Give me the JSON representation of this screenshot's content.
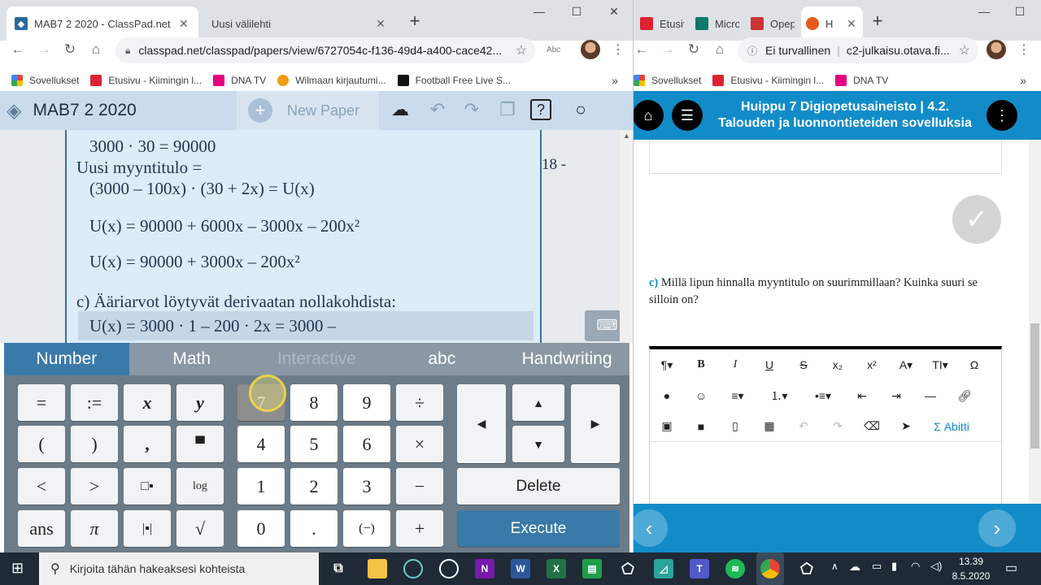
{
  "left_window": {
    "tabs": [
      {
        "title": "MAB7 2 2020 - ClassPad.net",
        "active": true
      },
      {
        "title": "Uusi välilehti",
        "active": false
      }
    ],
    "url": "classpad.net/classpad/papers/view/6727054c-f136-49d4-a400-cace42...",
    "bookmarks": [
      "Sovellukset",
      "Etusivu - Kiimingin l...",
      "DNA TV",
      "Wilmaan kirjautumi...",
      "Football Free Live S..."
    ],
    "app_title": "MAB7 2 2020",
    "new_paper_label": "New Paper",
    "side_number": "18 -",
    "math_lines": [
      "3000 · 30  = 90000",
      "Uusi myyntitulo =",
      "(3000 – 100x) · (30 + 2x) = U(x)",
      "U(x) = 90000 + 6000x – 3000x – 200x²",
      "U(x) = 90000 + 3000x – 200x²",
      "c) Ääriarvot löytyvät derivaatan nollakohdista:",
      "U(x) = 3000 · 1 – 200 · 2x = 3000 –"
    ],
    "keyboard_tabs": [
      "Number",
      "Math",
      "Interactive",
      "abc",
      "Handwriting"
    ],
    "keys": {
      "eq": "=",
      "assign": ":=",
      "x": "x",
      "y": "y",
      "lparen": "(",
      "rparen": ")",
      "comma": ",",
      "lt": "<",
      "gt": ">",
      "log": "log",
      "ans": "ans",
      "pi": "π",
      "sqrt": "√",
      "n7": "7",
      "n8": "8",
      "n9": "9",
      "div": "÷",
      "n4": "4",
      "n5": "5",
      "n6": "6",
      "mul": "×",
      "n1": "1",
      "n2": "2",
      "n3": "3",
      "minus": "−",
      "n0": "0",
      "dot": ".",
      "neg": "(−)",
      "plus": "+",
      "up": "▲",
      "down": "▼",
      "left": "◀",
      "right": "▶",
      "delete": "Delete",
      "execute": "Execute"
    }
  },
  "right_window": {
    "tabs": [
      "Etusiv",
      "Micro",
      "Opep",
      "H"
    ],
    "url_prefix": "Ei turvallinen",
    "url": "c2-julkaisu.otava.fi...",
    "bookmarks": [
      "Sovellukset",
      "Etusivu - Kiimingin l...",
      "DNA TV"
    ],
    "header_title_line1": "Huippu 7 Digiopetusaineisto  |  4.2.",
    "header_title_line2": "Talouden ja luonnontieteiden sovelluksia",
    "question_label": "c)",
    "question_text": "Millä lipun hinnalla myyntitulo on suurimmillaan? Kuinka suuri se silloin on?",
    "abitti_label": "Σ Abitti"
  },
  "taskbar": {
    "search_placeholder": "Kirjoita tähän hakeaksesi kohteista",
    "time": "13.39",
    "date": "8.5.2020"
  },
  "colors": {
    "classpad_header": "#c9dbec",
    "keyboard_active": "#3a7aa8",
    "otava_blue": "#128cc9"
  }
}
